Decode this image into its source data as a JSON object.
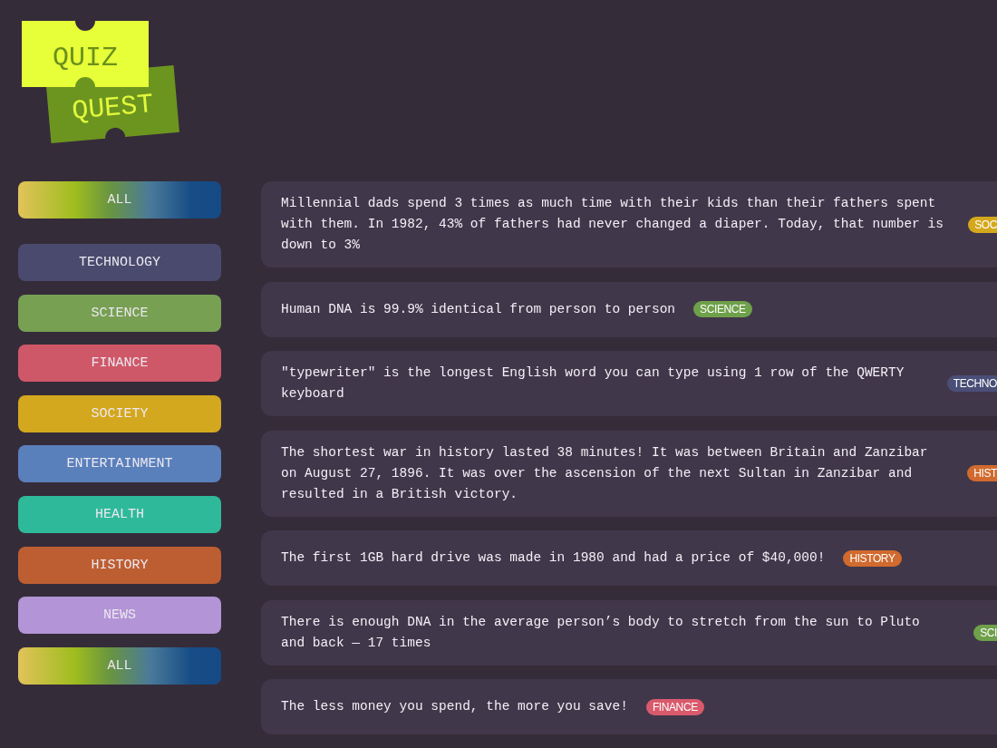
{
  "logo": {
    "front": "QUIZ",
    "back": "QUEST"
  },
  "categories": [
    {
      "label": "ALL",
      "kind": "gradient"
    },
    {
      "label": "TECHNOLOGY",
      "kind": "solid",
      "color": "#4a4a6e"
    },
    {
      "label": "SCIENCE",
      "kind": "solid",
      "color": "#77a052"
    },
    {
      "label": "FINANCE",
      "kind": "solid",
      "color": "#cf5868"
    },
    {
      "label": "SOCIETY",
      "kind": "solid",
      "color": "#d4a81e"
    },
    {
      "label": "ENTERTAINMENT",
      "kind": "solid",
      "color": "#5a80bc"
    },
    {
      "label": "HEALTH",
      "kind": "solid",
      "color": "#2fb99b"
    },
    {
      "label": "HISTORY",
      "kind": "solid",
      "color": "#bd5e32"
    },
    {
      "label": "NEWS",
      "kind": "solid",
      "color": "#b394d6"
    },
    {
      "label": "ALL",
      "kind": "gradient"
    }
  ],
  "facts": [
    {
      "text": "Millennial dads spend 3 times as much time with their kids than their fathers spent with them. In 1982, 43% of fathers had never changed a diaper. Today, that number is down to 3%",
      "tag": {
        "label": "SOC",
        "color": "#d4a81c",
        "cut_off": true
      }
    },
    {
      "text": "Human DNA is 99.9% identical from person to person",
      "tag": {
        "label": "SCIENCE",
        "color": "#6fa04a",
        "cut_off": false
      }
    },
    {
      "text": "\"typewriter\" is the longest English word you can type using 1 row of the QWERTY keyboard",
      "tag": {
        "label": "TECHNO",
        "color": "#4a4f78",
        "cut_off": true
      }
    },
    {
      "text": "The shortest war in history lasted 38 minutes! It was between Britain and Zanzibar on August 27, 1896. It was over the ascension of the next Sultan in Zanzibar and resulted in a British victory.",
      "tag": {
        "label": "HIST",
        "color": "#d06a2e",
        "cut_off": true
      }
    },
    {
      "text": "The first 1GB hard drive was made in 1980 and had a price of $40,000!",
      "tag": {
        "label": "HISTORY",
        "color": "#d06a2e",
        "cut_off": false
      }
    },
    {
      "text": "There is enough DNA in the average person’s body to stretch from the sun to Pluto and back — 17 times",
      "tag": {
        "label": "SCI",
        "color": "#6fa04a",
        "cut_off": true
      }
    },
    {
      "text": "The less money you spend, the more you save!",
      "tag": {
        "label": "FINANCE",
        "color": "#d95a6c",
        "cut_off": false
      }
    }
  ]
}
